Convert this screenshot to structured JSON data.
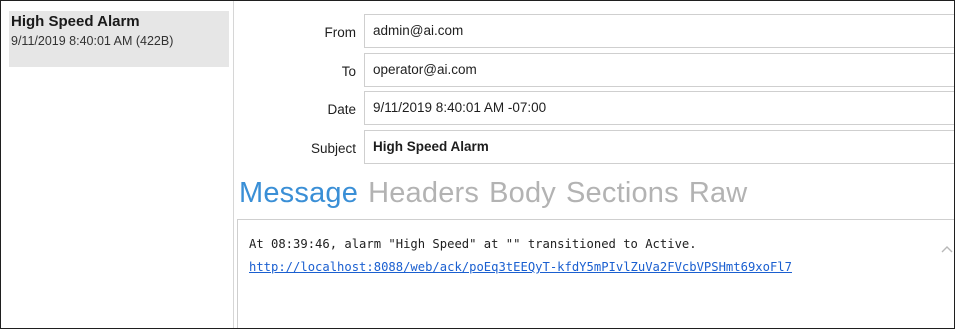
{
  "message_list": {
    "items": [
      {
        "subject": "High Speed Alarm",
        "meta": "9/11/2019 8:40:01 AM (422B)"
      }
    ]
  },
  "header": {
    "from_label": "From",
    "from_value": "admin@ai.com",
    "to_label": "To",
    "to_value": "operator@ai.com",
    "date_label": "Date",
    "date_value": "9/11/2019 8:40:01 AM -07:00",
    "subject_label": "Subject",
    "subject_value": "High Speed Alarm"
  },
  "tabs": {
    "message": "Message",
    "headers": "Headers",
    "body": "Body",
    "sections": "Sections",
    "raw": "Raw",
    "active": "Message"
  },
  "message": {
    "text": "At 08:39:46, alarm \"High Speed\" at \"\" transitioned to Active.",
    "link": "http://localhost:8088/web/ack/poEq3tEEQyT-kfdY5mPIvlZuVa2FVcbVPSHmt69xoFl7"
  },
  "icons": {
    "scroll_up": "chevron-up-icon"
  },
  "colors": {
    "active_tab": "#3a8fd6",
    "inactive_tab": "#b3b3b3",
    "link": "#1a5fd0",
    "selected_item_bg": "#e6e6e6"
  }
}
